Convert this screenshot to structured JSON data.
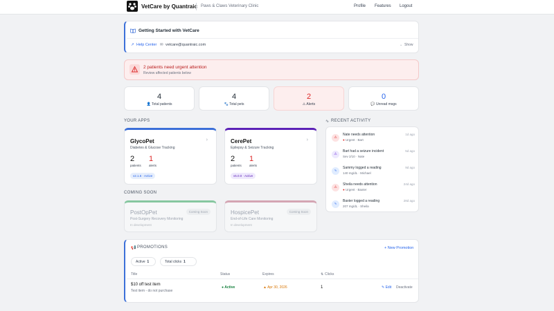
{
  "nav": {
    "brand": "VetCare by Quantraic",
    "clinic": "Paws & Claws Veterinary Clinic",
    "links": [
      "Profile",
      "Features",
      "Logout"
    ]
  },
  "getting_started": {
    "title": "Getting Started with VetCare",
    "help_label": "Help Center",
    "email": "vetcare@quantraic.com",
    "show_label": "Show"
  },
  "alert": {
    "title": "2 patients need urgent attention",
    "subtitle": "Review affected patients below"
  },
  "stats": [
    {
      "value": "4",
      "label": "Total patients",
      "color": "#1f2933"
    },
    {
      "value": "4",
      "label": "Total pets",
      "color": "#1f2933"
    },
    {
      "value": "2",
      "label": "Alerts",
      "color": "#dc2626"
    },
    {
      "value": "0",
      "label": "Unread msgs",
      "color": "#2563eb"
    }
  ],
  "your_apps": {
    "heading": "YOUR APPS",
    "apps": [
      {
        "name": "GlycoPet",
        "desc": "Diabetes & Glucose Tracking",
        "patients": "2",
        "alerts": "1",
        "patients_label": "patients",
        "alerts_label": "alerts",
        "badge": "v2.1.6 · Active",
        "accent": "#3b6fd8"
      },
      {
        "name": "CerePet",
        "desc": "Epilepsy & Seizure Tracking",
        "patients": "2",
        "alerts": "1",
        "patients_label": "patients",
        "alerts_label": "alerts",
        "badge": "v5.0.0 · Active",
        "accent": "#5b21b6"
      }
    ]
  },
  "coming_soon": {
    "heading": "COMING SOON",
    "apps": [
      {
        "name": "PostOpPet",
        "desc": "Post-Surgery Recovery Monitoring",
        "status": "In development",
        "badge": "Coming Soon",
        "accent": "#86c7a0"
      },
      {
        "name": "HospicePet",
        "desc": "End-of-Life Care Monitoring",
        "status": "In development",
        "badge": "Coming Soon",
        "accent": "#d4a5b3"
      }
    ]
  },
  "recent": {
    "heading": "RECENT ACTIVITY",
    "items": [
      {
        "title": "Nate needs attention",
        "sub": "Urgent · Bart",
        "ago": "1d ago",
        "icon": "alert-icon",
        "tint": "#fde2e2",
        "fg": "#dc2626"
      },
      {
        "title": "Bart had a seizure incident",
        "sub": "Sev 2/10 · Nate",
        "ago": "5d ago",
        "icon": "warning-icon",
        "tint": "#ede9fe",
        "fg": "#6d28d9"
      },
      {
        "title": "Sammy logged a reading",
        "sub": "140 mg/dL · Michael",
        "ago": "9d ago",
        "icon": "pulse-icon",
        "tint": "#e0ecff",
        "fg": "#2563eb"
      },
      {
        "title": "Sheila needs attention",
        "sub": "Urgent · Baxter",
        "ago": "24d ago",
        "icon": "alert-icon",
        "tint": "#fde2e2",
        "fg": "#dc2626"
      },
      {
        "title": "Baxter logged a reading",
        "sub": "207 mg/dL · Sheila",
        "ago": "28d ago",
        "icon": "pulse-icon",
        "tint": "#e0ecff",
        "fg": "#2563eb"
      }
    ]
  },
  "promotions": {
    "heading": "PROMOTIONS",
    "new_label": "+ New Promotion",
    "active_label": "Active",
    "active_count": "1",
    "clicks_label": "Total clicks",
    "clicks_count": "1",
    "columns": [
      "Title",
      "Status",
      "Expires",
      "Clicks"
    ],
    "rows": [
      {
        "title": "$10 off test item",
        "sub": "Test item - do not purchase",
        "status": "Active",
        "expires": "Apr 30, 2026",
        "clicks": "1",
        "edit": "Edit",
        "deactivate": "Deactivate"
      }
    ]
  }
}
